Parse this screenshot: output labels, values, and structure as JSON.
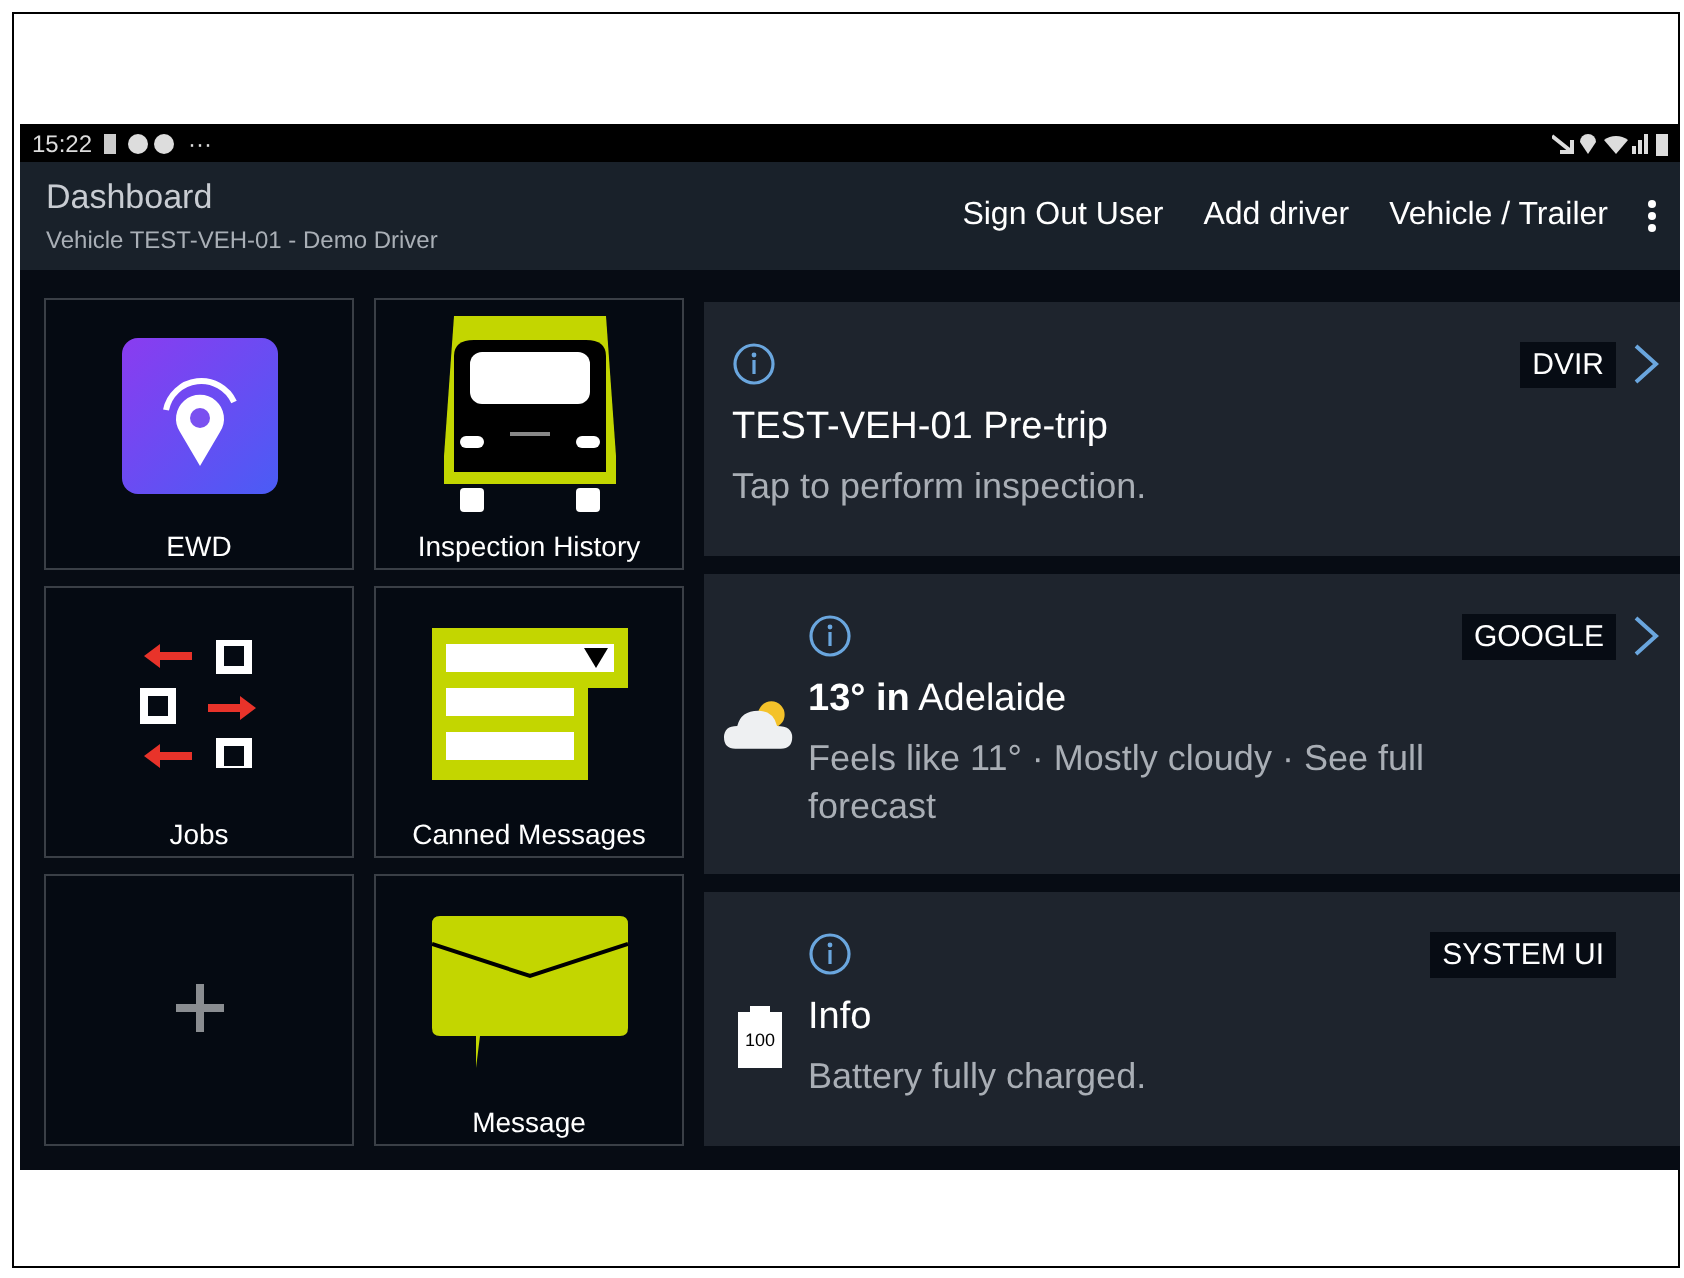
{
  "status_bar": {
    "time": "15:22",
    "overflow": "···"
  },
  "app_bar": {
    "title": "Dashboard",
    "subtitle": "Vehicle  TEST-VEH-01 - Demo Driver",
    "actions": [
      "Sign Out User",
      "Add driver",
      "Vehicle / Trailer"
    ]
  },
  "tiles": [
    {
      "kind": "ewd",
      "label": "EWD"
    },
    {
      "kind": "truck",
      "label": "Inspection History"
    },
    {
      "kind": "jobs",
      "label": "Jobs"
    },
    {
      "kind": "canned",
      "label": "Canned Messages"
    },
    {
      "kind": "add"
    },
    {
      "kind": "message",
      "label": "Message"
    }
  ],
  "notifications": [
    {
      "kind": "plain",
      "source": "DVIR",
      "has_arrow": true,
      "title": "TEST-VEH-01 Pre-trip",
      "body": "Tap to perform inspection."
    },
    {
      "kind": "weather",
      "source": "GOOGLE",
      "has_arrow": true,
      "title": "**13° in** Adelaide",
      "body": "Feels like 11° · Mostly cloudy · See full forecast"
    },
    {
      "kind": "battery",
      "icon_label": "100",
      "source": "SYSTEM UI",
      "has_arrow": false,
      "title": "Info",
      "body": "Battery fully charged."
    }
  ]
}
